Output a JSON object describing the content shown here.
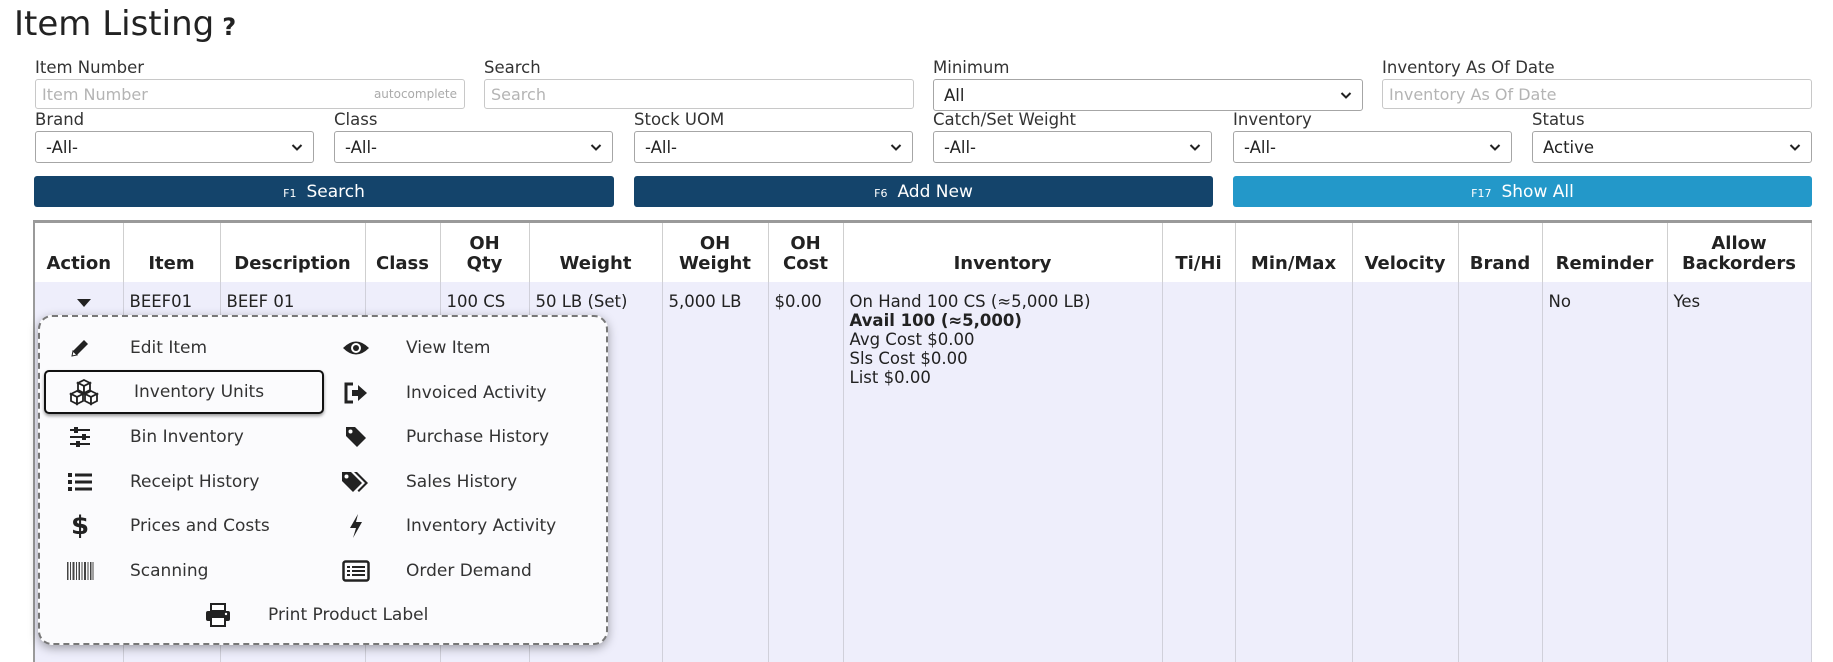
{
  "header": {
    "title": "Item Listing",
    "help": "?"
  },
  "filters": {
    "item_number": {
      "label": "Item Number",
      "placeholder": "Item Number",
      "hint": "autocomplete"
    },
    "search": {
      "label": "Search",
      "placeholder": "Search"
    },
    "minimum": {
      "label": "Minimum",
      "value": "All"
    },
    "inventory_as_of": {
      "label": "Inventory As Of Date",
      "placeholder": "Inventory As Of Date"
    },
    "brand": {
      "label": "Brand",
      "value": "-All-"
    },
    "class": {
      "label": "Class",
      "value": "-All-"
    },
    "stock_uom": {
      "label": "Stock UOM",
      "value": "-All-"
    },
    "catch_set_weight": {
      "label": "Catch/Set Weight",
      "value": "-All-"
    },
    "inventory": {
      "label": "Inventory",
      "value": "-All-"
    },
    "status": {
      "label": "Status",
      "value": "Active"
    }
  },
  "buttons": {
    "search": {
      "key": "F1",
      "label": "Search"
    },
    "add_new": {
      "key": "F6",
      "label": "Add New"
    },
    "show_all": {
      "key": "F17",
      "label": "Show All"
    }
  },
  "table": {
    "columns": {
      "action": "Action",
      "item": "Item",
      "description": "Description",
      "class": "Class",
      "oh_qty_1": "OH",
      "oh_qty_2": "Qty",
      "weight": "Weight",
      "oh_weight_1": "OH",
      "oh_weight_2": "Weight",
      "oh_cost_1": "OH",
      "oh_cost_2": "Cost",
      "inventory": "Inventory",
      "ti_hi": "Ti/Hi",
      "min_max": "Min/Max",
      "velocity": "Velocity",
      "brand": "Brand",
      "reminder": "Reminder",
      "allow_backorders_1": "Allow",
      "allow_backorders_2": "Backorders"
    },
    "row": {
      "item": "BEEF01",
      "description": "BEEF 01",
      "class": "",
      "oh_qty": "100 CS",
      "weight": "50 LB (Set)",
      "oh_weight": "5,000 LB",
      "oh_cost": "$0.00",
      "inventory": {
        "on_hand": "On Hand 100 CS (≈5,000 LB)",
        "avail": "Avail 100 (≈5,000)",
        "avg_cost": "Avg Cost $0.00",
        "sls_cost": "Sls Cost $0.00",
        "list": "List $0.00"
      },
      "ti_hi": "",
      "min_max": "",
      "velocity": "",
      "brand": "",
      "reminder": "No",
      "allow_backorders": "Yes"
    }
  },
  "action_menu": {
    "edit_item": "Edit Item",
    "view_item": "View Item",
    "inventory_units": "Inventory Units",
    "invoiced_activity": "Invoiced Activity",
    "bin_inventory": "Bin Inventory",
    "purchase_history": "Purchase History",
    "receipt_history": "Receipt History",
    "sales_history": "Sales History",
    "prices_and_costs": "Prices and Costs",
    "inventory_activity": "Inventory Activity",
    "scanning": "Scanning",
    "order_demand": "Order Demand",
    "print_product_label": "Print Product Label",
    "selected_item": "inventory_units"
  },
  "colors": {
    "primary_button": "#14446b",
    "secondary_button": "#2398c9",
    "row_background": "#eeeefb"
  },
  "icons": {
    "edit_item": "pencil-icon",
    "view_item": "eye-icon",
    "inventory_units": "cubes-icon",
    "invoiced_activity": "sign-out-icon",
    "bin_inventory": "sliders-icon",
    "purchase_history": "tag-icon",
    "receipt_history": "list-icon",
    "sales_history": "tags-icon",
    "prices_and_costs": "dollar-icon",
    "inventory_activity": "bolt-icon",
    "scanning": "barcode-icon",
    "order_demand": "list-alt-icon",
    "print_product_label": "print-icon"
  }
}
